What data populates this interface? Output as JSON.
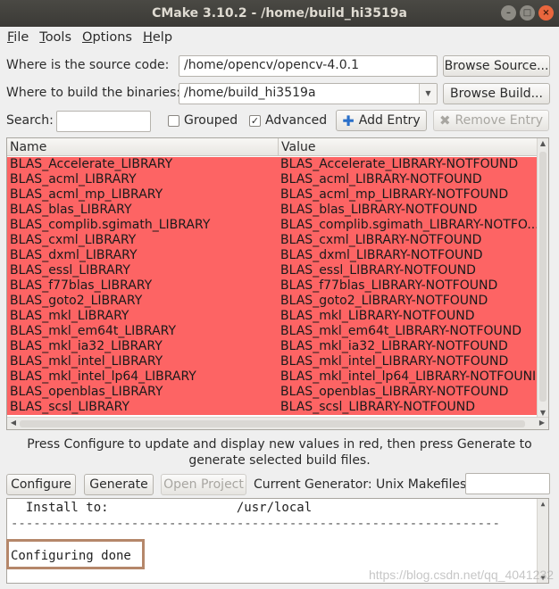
{
  "window": {
    "title": "CMake 3.10.2 - /home/build_hi3519a"
  },
  "menu": [
    {
      "hot": "F",
      "rest": "ile"
    },
    {
      "hot": "T",
      "rest": "ools"
    },
    {
      "hot": "O",
      "rest": "ptions"
    },
    {
      "hot": "H",
      "rest": "elp"
    }
  ],
  "source": {
    "label": "Where is the source code:",
    "value": "/home/opencv/opencv-4.0.1",
    "browse": "Browse Source..."
  },
  "build": {
    "label": "Where to build the binaries:",
    "value": "/home/build_hi3519a",
    "browse": "Browse Build..."
  },
  "toolbar": {
    "search_label": "Search:",
    "search_value": "",
    "grouped_label": "Grouped",
    "grouped_checked": false,
    "advanced_label": "Advanced",
    "advanced_checked": true,
    "add_entry": "Add Entry",
    "remove_entry": "Remove Entry"
  },
  "table": {
    "headers": [
      "Name",
      "Value"
    ],
    "row_color": "#fd6464",
    "rows": [
      [
        "BLAS_Accelerate_LIBRARY",
        "BLAS_Accelerate_LIBRARY-NOTFOUND"
      ],
      [
        "BLAS_acml_LIBRARY",
        "BLAS_acml_LIBRARY-NOTFOUND"
      ],
      [
        "BLAS_acml_mp_LIBRARY",
        "BLAS_acml_mp_LIBRARY-NOTFOUND"
      ],
      [
        "BLAS_blas_LIBRARY",
        "BLAS_blas_LIBRARY-NOTFOUND"
      ],
      [
        "BLAS_complib.sgimath_LIBRARY",
        "BLAS_complib.sgimath_LIBRARY-NOTFO..."
      ],
      [
        "BLAS_cxml_LIBRARY",
        "BLAS_cxml_LIBRARY-NOTFOUND"
      ],
      [
        "BLAS_dxml_LIBRARY",
        "BLAS_dxml_LIBRARY-NOTFOUND"
      ],
      [
        "BLAS_essl_LIBRARY",
        "BLAS_essl_LIBRARY-NOTFOUND"
      ],
      [
        "BLAS_f77blas_LIBRARY",
        "BLAS_f77blas_LIBRARY-NOTFOUND"
      ],
      [
        "BLAS_goto2_LIBRARY",
        "BLAS_goto2_LIBRARY-NOTFOUND"
      ],
      [
        "BLAS_mkl_LIBRARY",
        "BLAS_mkl_LIBRARY-NOTFOUND"
      ],
      [
        "BLAS_mkl_em64t_LIBRARY",
        "BLAS_mkl_em64t_LIBRARY-NOTFOUND"
      ],
      [
        "BLAS_mkl_ia32_LIBRARY",
        "BLAS_mkl_ia32_LIBRARY-NOTFOUND"
      ],
      [
        "BLAS_mkl_intel_LIBRARY",
        "BLAS_mkl_intel_LIBRARY-NOTFOUND"
      ],
      [
        "BLAS_mkl_intel_lp64_LIBRARY",
        "BLAS_mkl_intel_lp64_LIBRARY-NOTFOUNI"
      ],
      [
        "BLAS_openblas_LIBRARY",
        "BLAS_openblas_LIBRARY-NOTFOUND"
      ],
      [
        "BLAS_scsl_LIBRARY",
        "BLAS_scsl_LIBRARY-NOTFOUND"
      ]
    ]
  },
  "info_text": "Press Configure to update and display new values in red, then press Generate to generate selected build files.",
  "actions": {
    "configure": "Configure",
    "generate": "Generate",
    "open_project": "Open Project",
    "generator_label": "Current Generator: Unix Makefiles",
    "generator_value": ""
  },
  "output": {
    "lines": [
      "  Install to:                 /usr/local",
      "-----------------------------------------------------------------",
      "",
      "Configuring done"
    ]
  },
  "watermark": "https://blog.csdn.net/qq_4041232"
}
